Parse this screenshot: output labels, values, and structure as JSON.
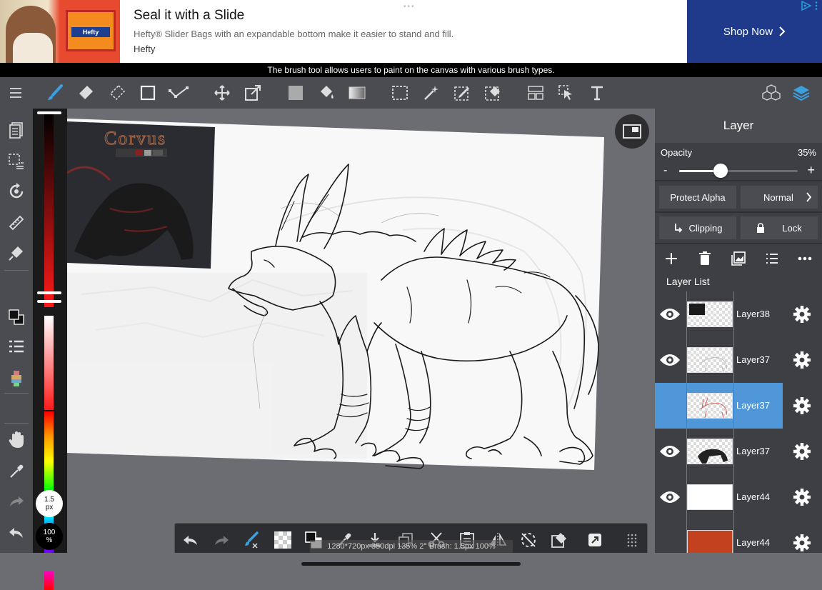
{
  "ad": {
    "title": "Seal it with a Slide",
    "description": "Hefty® Slider Bags with an expandable bottom make it easier to stand and fill.",
    "brand": "Hefty",
    "cta": "Shop Now",
    "product_label": "Hefty",
    "cta_color": "#1f3a8a"
  },
  "tooltip": "The brush tool allows users to paint on the canvas with various brush types.",
  "left_strip": {
    "brush_size": "1.5",
    "brush_unit": "px",
    "opacity_value": "100",
    "opacity_unit": "%"
  },
  "canvas": {
    "reference_title": "Corvus"
  },
  "layer_panel": {
    "title": "Layer",
    "opacity_label": "Opacity",
    "opacity_value": "35%",
    "opacity_level": 0.35,
    "protect_alpha": "Protect Alpha",
    "blend_mode": "Normal",
    "clipping": "Clipping",
    "lock": "Lock",
    "layer_list_label": "Layer List",
    "accent_color": "#5097d9",
    "layers": [
      {
        "name": "Layer38",
        "visible": true,
        "selected": false
      },
      {
        "name": "Layer37",
        "visible": true,
        "selected": false
      },
      {
        "name": "Layer37",
        "visible": false,
        "selected": true
      },
      {
        "name": "Layer37",
        "visible": true,
        "selected": false
      },
      {
        "name": "Layer44",
        "visible": true,
        "selected": false
      },
      {
        "name": "Layer44",
        "visible": false,
        "selected": false
      }
    ]
  },
  "status_bar": "1280*720px 350dpi 135% 2° Brush: 1.5px 100%"
}
